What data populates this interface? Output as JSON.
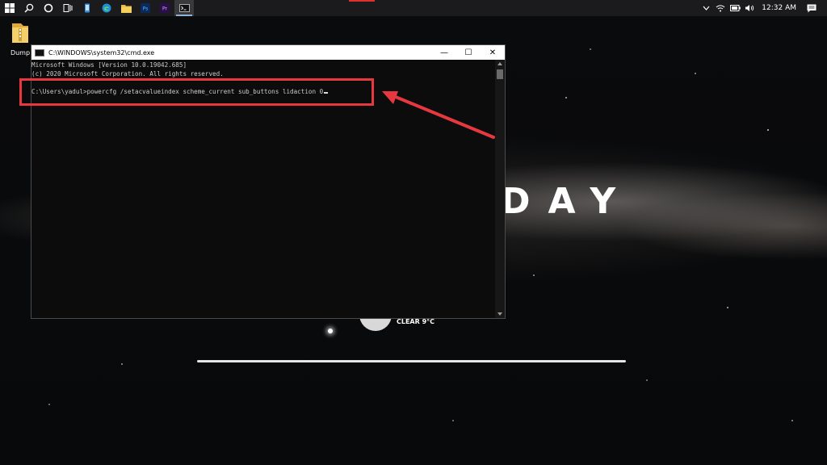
{
  "taskbar": {
    "apps": [
      {
        "name": "start-icon"
      },
      {
        "name": "search-icon"
      },
      {
        "name": "cortana-icon"
      },
      {
        "name": "task-view-icon"
      },
      {
        "name": "phone-app-icon"
      },
      {
        "name": "edge-icon"
      },
      {
        "name": "file-explorer-icon"
      },
      {
        "name": "photoshop-icon",
        "label": "Ps"
      },
      {
        "name": "premiere-icon",
        "label": "Pr"
      },
      {
        "name": "cmd-icon"
      }
    ],
    "clock": "12:32 AM",
    "colors": {
      "background": "#1b1b1d",
      "active_indicator": "#8fb3d9",
      "photoshop": "#0b2a5b",
      "premiere": "#2a0f4a"
    }
  },
  "desktop": {
    "icons": [
      {
        "label": "Dump"
      }
    ]
  },
  "cmd_window": {
    "title": "C:\\WINDOWS\\system32\\cmd.exe",
    "controls": {
      "minimize": "—",
      "maximize": "☐",
      "close": "✕"
    },
    "lines": [
      "Microsoft Windows [Version 10.0.19042.685]",
      "(c) 2020 Microsoft Corporation. All rights reserved.",
      "C:\\Users\\yadul>powercfg /setacvalueindex scheme_current sub_buttons lidaction 0"
    ]
  },
  "wallpaper": {
    "brand_text": "DAY",
    "weather": "CLEAR 9°C"
  },
  "annotation": {
    "color": "#e8383f"
  }
}
